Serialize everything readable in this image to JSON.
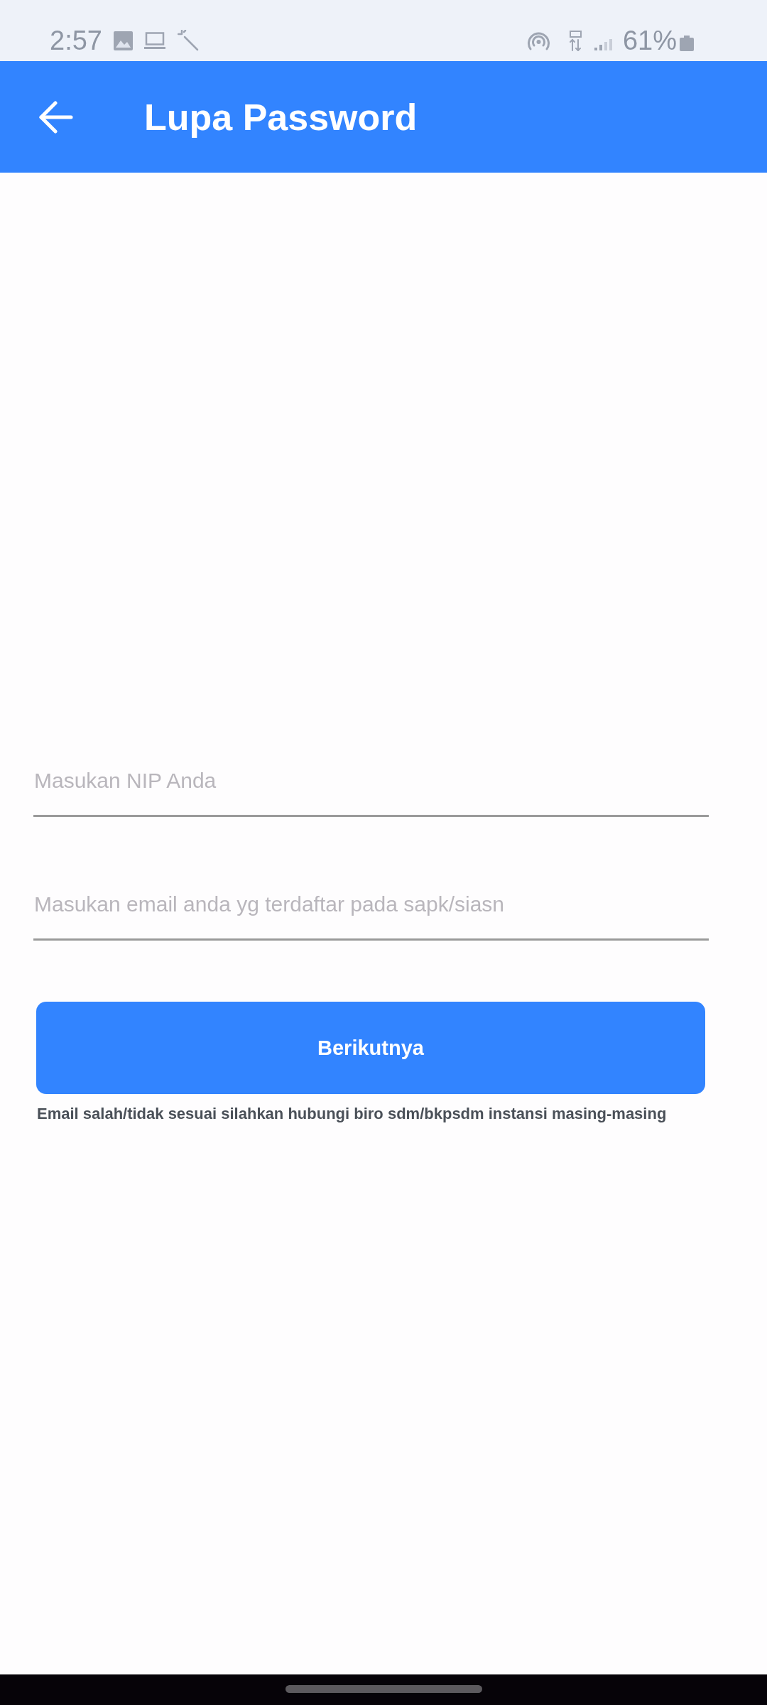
{
  "status_bar": {
    "time": "2:57",
    "battery": "61%"
  },
  "app_bar": {
    "title": "Lupa Password"
  },
  "form": {
    "fields": [
      {
        "placeholder": "Masukan NIP Anda"
      },
      {
        "placeholder": "Masukan email anda yg terdaftar pada sapk/siasn"
      }
    ],
    "submit_button": "Berikutnya",
    "note": "Email salah/tidak sesuai silahkan hubungi biro sdm/bkpsdm instansi masing-masing"
  }
}
